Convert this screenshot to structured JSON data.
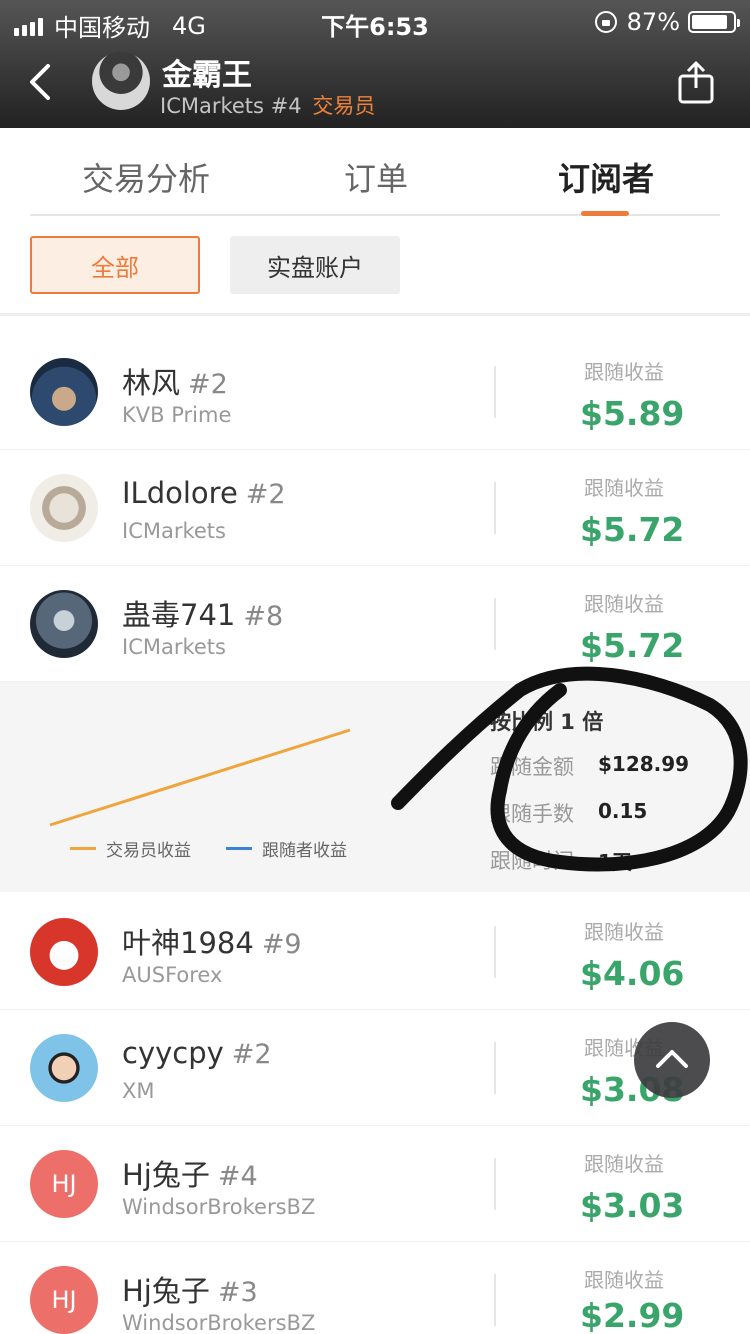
{
  "status": {
    "carrier": "中国移动",
    "network": "4G",
    "time": "下午6:53",
    "battery": "87%",
    "battery_fraction": 0.87
  },
  "header": {
    "name": "金霸王",
    "broker": "ICMarkets",
    "rank": "#4",
    "role": "交易员"
  },
  "tabs": [
    {
      "label": "交易分析"
    },
    {
      "label": "订单"
    },
    {
      "label": "订阅者",
      "active": true
    }
  ],
  "filters": {
    "all": "全部",
    "real": "实盘账户"
  },
  "rows": [
    {
      "name": "林风",
      "rank": "#2",
      "broker": "KVB Prime",
      "earn_label": "跟随收益",
      "earn": "$5.89"
    },
    {
      "name": "ILdolore",
      "rank": "#2",
      "broker": "ICMarkets",
      "earn_label": "跟随收益",
      "earn": "$5.72"
    },
    {
      "name": "蛊毒741",
      "rank": "#8",
      "broker": "ICMarkets",
      "earn_label": "跟随收益",
      "earn": "$5.72"
    },
    {
      "name": "叶神1984",
      "rank": "#9",
      "broker": "AUSForex",
      "earn_label": "跟随收益",
      "earn": "$4.06"
    },
    {
      "name": "cyycpy",
      "rank": "#2",
      "broker": "XM",
      "earn_label": "跟随收益",
      "earn": "$3.08"
    },
    {
      "name": "Hj兔子",
      "rank": "#4",
      "broker": "WindsorBrokersBZ",
      "earn_label": "跟随收益",
      "earn": "$3.03",
      "initials": "HJ"
    },
    {
      "name": "Hj兔子",
      "rank": "#3",
      "broker": "WindsorBrokersBZ",
      "earn_label": "跟随收益",
      "earn": "$2.99",
      "initials": "HJ"
    }
  ],
  "detail": {
    "ratio": "按比例 1 倍",
    "amount_label": "跟随金额",
    "amount": "$128.99",
    "lots_label": "跟随手数",
    "lots": "0.15",
    "time_label": "跟随时间",
    "time": "1天",
    "legend_trader": "交易员收益",
    "legend_follower": "跟随者收益",
    "trader_color": "#f0a43c",
    "follower_color": "#3b82d8"
  },
  "colors": {
    "accent": "#ef7b3a",
    "positive": "#3aa56a"
  }
}
